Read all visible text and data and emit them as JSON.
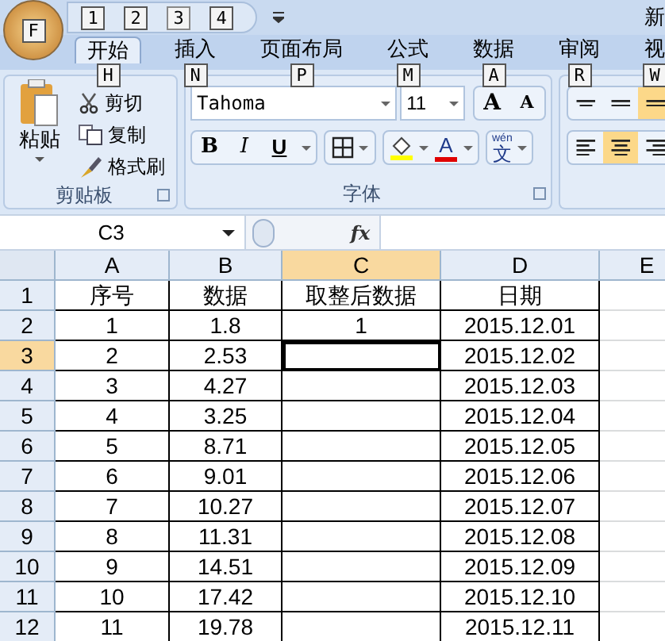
{
  "office_button": {
    "keytip": "F"
  },
  "quick_access": {
    "keytips": [
      "1",
      "2",
      "3",
      "4"
    ]
  },
  "title": "新",
  "tabs": [
    {
      "label": "开始",
      "keytip": "H",
      "selected": true
    },
    {
      "label": "插入",
      "keytip": "N",
      "selected": false
    },
    {
      "label": "页面布局",
      "keytip": "P",
      "selected": false
    },
    {
      "label": "公式",
      "keytip": "M",
      "selected": false
    },
    {
      "label": "数据",
      "keytip": "A",
      "selected": false
    },
    {
      "label": "审阅",
      "keytip": "R",
      "selected": false
    },
    {
      "label": "视",
      "keytip": "W",
      "selected": false
    }
  ],
  "clipboard": {
    "paste": "粘贴",
    "items": [
      {
        "kind": "cut",
        "label": "剪切"
      },
      {
        "kind": "copy",
        "label": "复制"
      },
      {
        "kind": "painter",
        "label": "格式刷"
      }
    ],
    "label": "剪贴板"
  },
  "font": {
    "name": "Tahoma",
    "size": "11",
    "grow": "A",
    "shrink": "A",
    "bold": "B",
    "italic": "I",
    "underline": "U",
    "font_color": "A",
    "phonetic": "文",
    "phonetic_pinyin": "wén",
    "label": "字体"
  },
  "alignment": [
    {
      "buttons": [
        {
          "kind": "top",
          "selected": false
        },
        {
          "kind": "middle",
          "selected": false
        },
        {
          "kind": "bottom",
          "selected": true
        }
      ]
    },
    {
      "buttons": [
        {
          "kind": "left",
          "selected": false
        },
        {
          "kind": "center",
          "selected": true
        },
        {
          "kind": "right",
          "selected": false
        }
      ]
    }
  ],
  "name_box": "C3",
  "formula_button": "fx",
  "columns": [
    {
      "label": "A",
      "selected": false
    },
    {
      "label": "B",
      "selected": false
    },
    {
      "label": "C",
      "selected": true
    },
    {
      "label": "D",
      "selected": false
    },
    {
      "label": "E",
      "selected": false
    }
  ],
  "rows": [
    {
      "number": "1",
      "selected": false,
      "cells": [
        "序号",
        "数据",
        "取整后数据",
        "日期"
      ]
    },
    {
      "number": "2",
      "selected": false,
      "cells": [
        "1",
        "1.8",
        "1",
        "2015.12.01"
      ]
    },
    {
      "number": "3",
      "selected": true,
      "cells": [
        "2",
        "2.53",
        null,
        "2015.12.02"
      ]
    },
    {
      "number": "4",
      "selected": false,
      "cells": [
        "3",
        "4.27",
        null,
        "2015.12.03"
      ]
    },
    {
      "number": "5",
      "selected": false,
      "cells": [
        "4",
        "3.25",
        null,
        "2015.12.04"
      ]
    },
    {
      "number": "6",
      "selected": false,
      "cells": [
        "5",
        "8.71",
        null,
        "2015.12.05"
      ]
    },
    {
      "number": "7",
      "selected": false,
      "cells": [
        "6",
        "9.01",
        null,
        "2015.12.06"
      ]
    },
    {
      "number": "8",
      "selected": false,
      "cells": [
        "7",
        "10.27",
        null,
        "2015.12.07"
      ]
    },
    {
      "number": "9",
      "selected": false,
      "cells": [
        "8",
        "11.31",
        null,
        "2015.12.08"
      ]
    },
    {
      "number": "10",
      "selected": false,
      "cells": [
        "9",
        "14.51",
        null,
        "2015.12.09"
      ]
    },
    {
      "number": "11",
      "selected": false,
      "cells": [
        "10",
        "17.42",
        null,
        "2015.12.10"
      ]
    },
    {
      "number": "12",
      "selected": false,
      "cells": [
        "11",
        "19.78",
        null,
        "2015.12.11"
      ]
    }
  ]
}
